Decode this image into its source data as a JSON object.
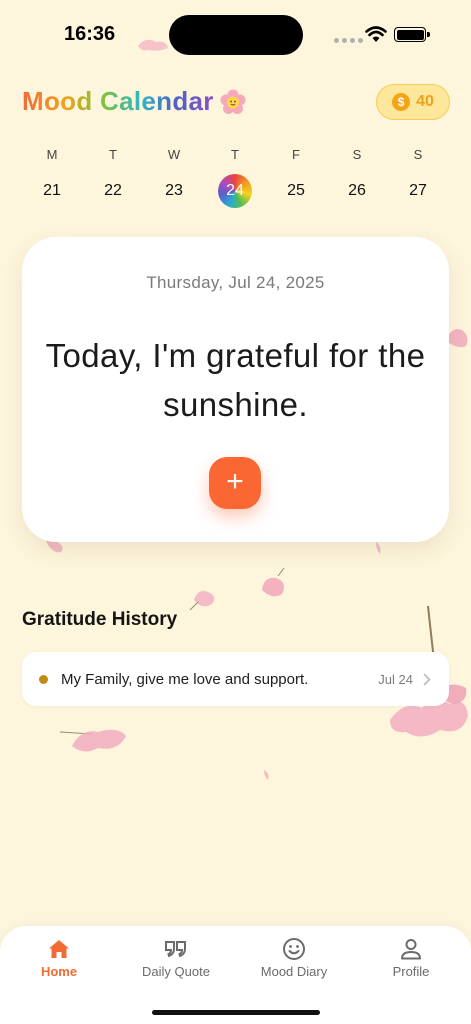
{
  "status_bar": {
    "time": "16:36"
  },
  "header": {
    "title": "Mood Calendar",
    "coins": "40",
    "coin_symbol": "$",
    "title_gradient": [
      "#ef6a3c",
      "#f1a21e",
      "#7fc23b",
      "#2fb5c6",
      "#4c63c7",
      "#8a4fc2"
    ]
  },
  "week": {
    "days": [
      {
        "letter": "M",
        "date": "21"
      },
      {
        "letter": "T",
        "date": "22"
      },
      {
        "letter": "W",
        "date": "23"
      },
      {
        "letter": "T",
        "date": "24",
        "selected": true
      },
      {
        "letter": "F",
        "date": "25"
      },
      {
        "letter": "S",
        "date": "26"
      },
      {
        "letter": "S",
        "date": "27"
      }
    ]
  },
  "card": {
    "date": "Thursday, Jul 24, 2025",
    "quote": "Today, I'm grateful for the sunshine.",
    "add_label": "+"
  },
  "history": {
    "title": "Gratitude History",
    "items": [
      {
        "text": "My Family, give me love and support.",
        "date": "Jul 24"
      }
    ]
  },
  "tabs": [
    {
      "label": "Home",
      "icon": "home-icon",
      "active": true
    },
    {
      "label": "Daily Quote",
      "icon": "quote-icon"
    },
    {
      "label": "Mood Diary",
      "icon": "smiley-icon"
    },
    {
      "label": "Profile",
      "icon": "person-icon"
    }
  ],
  "colors": {
    "background": "#fdf5dc",
    "accent": "#fa6733",
    "coin_badge": "#fde79b",
    "coin_text": "#f0a31a",
    "history_dot": "#c08b12"
  }
}
